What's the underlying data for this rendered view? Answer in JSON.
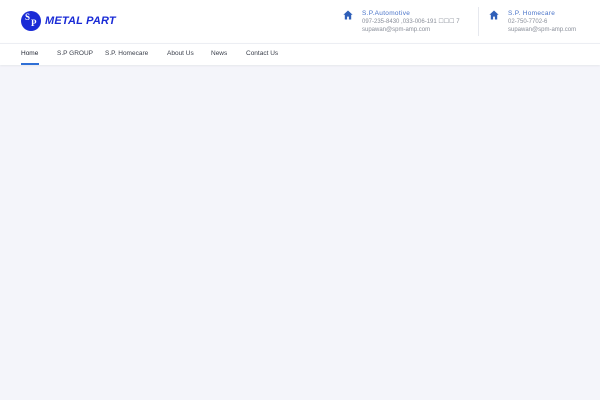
{
  "logo": {
    "text": "METAL PART",
    "mark_s": "S",
    "mark_p": "P"
  },
  "contacts": [
    {
      "icon": "home-icon",
      "title": "S.P.Automotive",
      "phone": "097-235-8430 ,033-006-191 ☐☐☐ 7",
      "email": "supawan@spm-amp.com"
    },
    {
      "icon": "home-icon",
      "title": "S.P. Homecare",
      "phone": "02-750-7702-6",
      "email": "supawan@spm-amp.com"
    }
  ],
  "nav": {
    "items": [
      {
        "label": "Home",
        "active": true
      },
      {
        "label": "S.P GROUP"
      },
      {
        "label": "S.P. Homecare"
      },
      {
        "label": "About Us"
      },
      {
        "label": "News"
      },
      {
        "label": "Contact Us"
      }
    ]
  },
  "colors": {
    "brand": "#1a2bd6",
    "accent": "#2f6fd6",
    "background": "#f4f5fa"
  }
}
